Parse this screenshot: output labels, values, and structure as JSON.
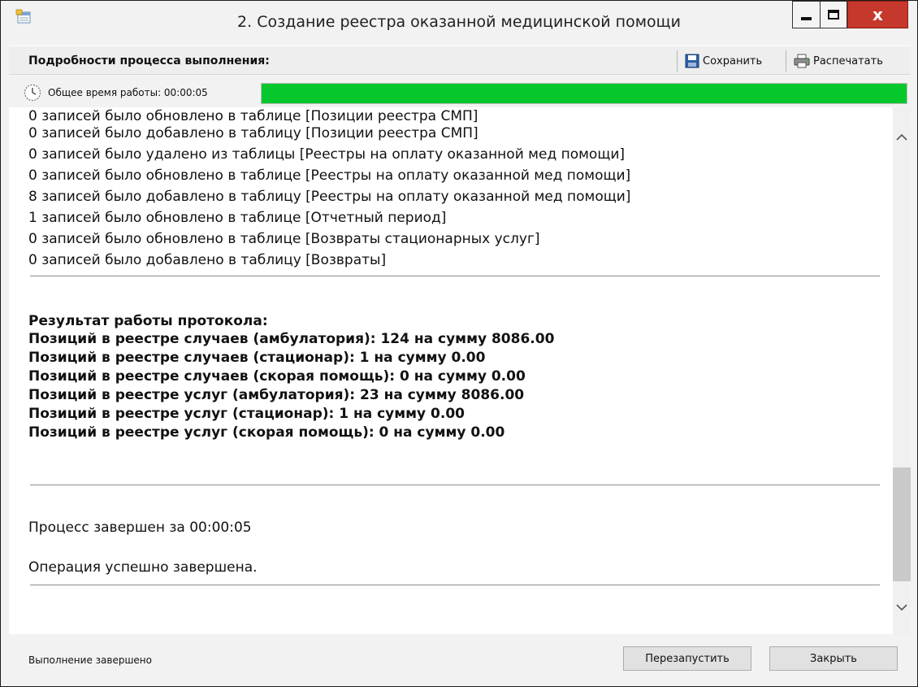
{
  "window": {
    "title": "2. Создание реестра оказанной медицинской помощи",
    "close_glyph": "x"
  },
  "details": {
    "label": "Подробности процесса выполнения:",
    "save_label": "Сохранить",
    "print_label": "Распечатать"
  },
  "progress": {
    "time_label": "Общее время работы: 00:00:05",
    "percent": 100,
    "color": "#06c72c"
  },
  "log": {
    "lines": [
      "0 записей было обновлено в таблице [Позиции реестра СМП]",
      "0 записей было добавлено в таблицу [Позиции реестра СМП]",
      "0 записей было удалено из таблицы [Реестры на оплату оказанной мед помощи]",
      "0 записей было обновлено в таблице [Реестры на оплату оказанной мед помощи]",
      "8 записей было добавлено в таблицу [Реестры на оплату оказанной мед помощи]",
      "1 записей было обновлено в таблице [Отчетный период]",
      "0 записей было обновлено в таблице [Возвраты стационарных услуг]",
      "0 записей было добавлено в таблицу [Возвраты]"
    ],
    "result_title": "Результат работы протокола:",
    "results": [
      "Позиций в реестре случаев (амбулатория): 124 на сумму 8086.00",
      "Позиций в реестре случаев (стационар): 1 на сумму 0.00",
      "Позиций в реестре случаев (скорая помощь): 0 на сумму 0.00",
      "Позиций в реестре услуг (амбулатория): 23 на сумму 8086.00",
      "Позиций в реестре услуг (стационар): 1 на сумму 0.00",
      "Позиций в реестре услуг (скорая помощь): 0 на сумму 0.00"
    ],
    "process_done": "Процесс завершен за 00:00:05",
    "operation_done": "Операция успешно завершена."
  },
  "status": {
    "text": "Выполнение завершено",
    "restart_label": "Перезапустить",
    "close_label": "Закрыть"
  }
}
